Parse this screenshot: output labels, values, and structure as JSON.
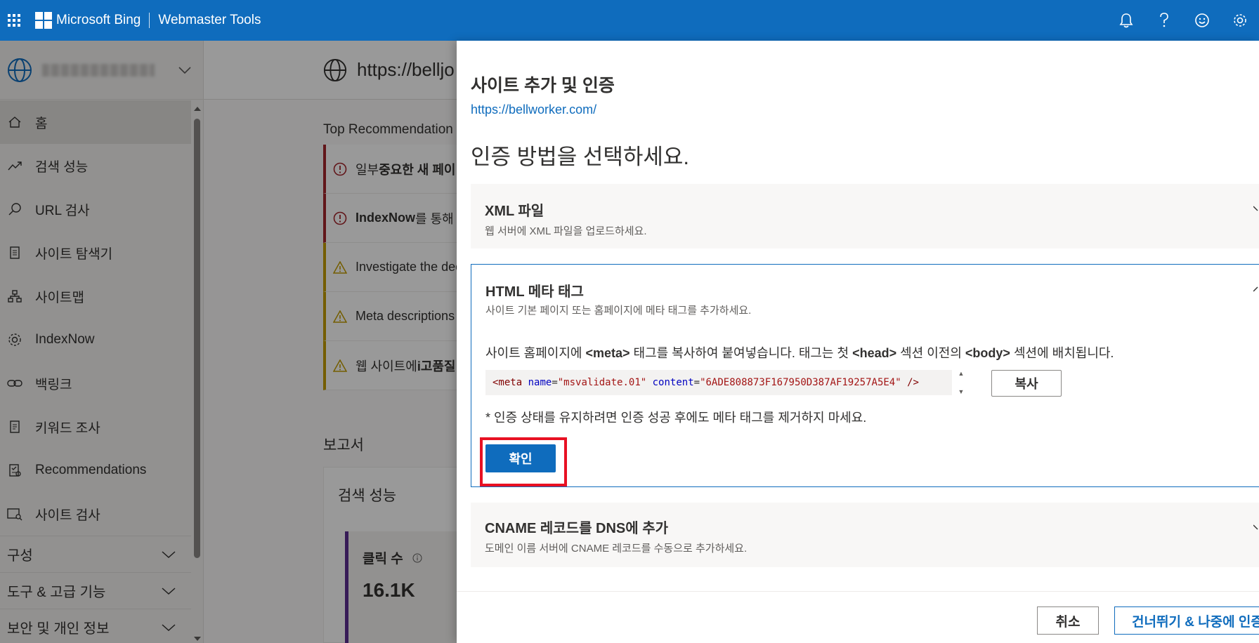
{
  "topbar": {
    "brand": "Microsoft Bing",
    "product": "Webmaster Tools",
    "icons": [
      "bell-icon",
      "help-icon",
      "smiley-icon",
      "gear-icon"
    ]
  },
  "sidebar": {
    "items": [
      {
        "label": "홈",
        "icon": "home-icon"
      },
      {
        "label": "검색 성능",
        "icon": "trend-icon"
      },
      {
        "label": "URL 검사",
        "icon": "search-icon"
      },
      {
        "label": "사이트 탐색기",
        "icon": "document-icon"
      },
      {
        "label": "사이트맵",
        "icon": "sitemap-icon"
      },
      {
        "label": "IndexNow",
        "icon": "gear-icon"
      },
      {
        "label": "백링크",
        "icon": "link-icon"
      },
      {
        "label": "키워드 조사",
        "icon": "document-icon"
      },
      {
        "label": "Recommendations",
        "icon": "checklist-icon"
      },
      {
        "label": "사이트 검사",
        "icon": "scan-icon"
      }
    ],
    "sections": [
      {
        "label": "구성"
      },
      {
        "label": "도구 & 고급 기능"
      },
      {
        "label": "보안 및 개인 정보"
      }
    ]
  },
  "main": {
    "url": "https://belljo",
    "rec_title": "Top Recommendation",
    "recs": [
      {
        "prefix": "일부 ",
        "bold": "중요한 새 페이",
        "kind": "error"
      },
      {
        "prefix": "",
        "bold": "IndexNow",
        "suffix": "를 통해",
        "kind": "error"
      },
      {
        "prefix": "Investigate the dec",
        "bold": "",
        "kind": "warning"
      },
      {
        "prefix": "Meta descriptions c",
        "bold": "",
        "kind": "warning"
      },
      {
        "prefix": "웹 사이트에 ",
        "bold": "i고품질",
        "kind": "warning"
      }
    ],
    "report_title": "보고서",
    "report_card_title": "검색 성능",
    "clicks_label": "클릭 수",
    "clicks_value": "16.1K"
  },
  "panel": {
    "title": "사이트 추가 및 인증",
    "url": "https://bellworker.com/",
    "heading": "인증 방법을 선택하세요.",
    "options": {
      "xml": {
        "title": "XML 파일",
        "desc": "웹 서버에 XML 파일을 업로드하세요."
      },
      "html": {
        "title": "HTML 메타 태그",
        "desc": "사이트 기본 페이지 또는 홈페이지에 메타 태그를 추가하세요.",
        "instruction_1": "사이트 홈페이지에 ",
        "instruction_meta": "<meta>",
        "instruction_2": " 태그를 복사하여 붙여넣습니다. 태그는 첫 ",
        "instruction_head": "<head>",
        "instruction_3": " 섹션 이전의 ",
        "instruction_body": "<body>",
        "instruction_4": " 섹션에 배치됩니다.",
        "meta_open": "<meta",
        "meta_name_attr": "name",
        "meta_name_value": "\"msvalidate.01\"",
        "meta_content_attr": "content",
        "meta_content_value": "\"6ADE808873F167950D387AF19257A5E4\"",
        "meta_close": "/>",
        "copy_label": "복사",
        "note": "* 인증 상태를 유지하려면 인증 성공 후에도 메타 태그를 제거하지 마세요.",
        "confirm_label": "확인"
      },
      "cname": {
        "title": "CNAME 레코드를 DNS에 추가",
        "desc": "도메인 이름 서버에 CNAME 레코드를 수동으로 추가하세요."
      }
    },
    "cancel_label": "취소",
    "skip_label": "건너뛰기 & 나중에 인증"
  },
  "colors": {
    "accent": "#0f6cbd",
    "highlight": "#e81123",
    "error": "#a4262c",
    "warning": "#c19c00"
  }
}
